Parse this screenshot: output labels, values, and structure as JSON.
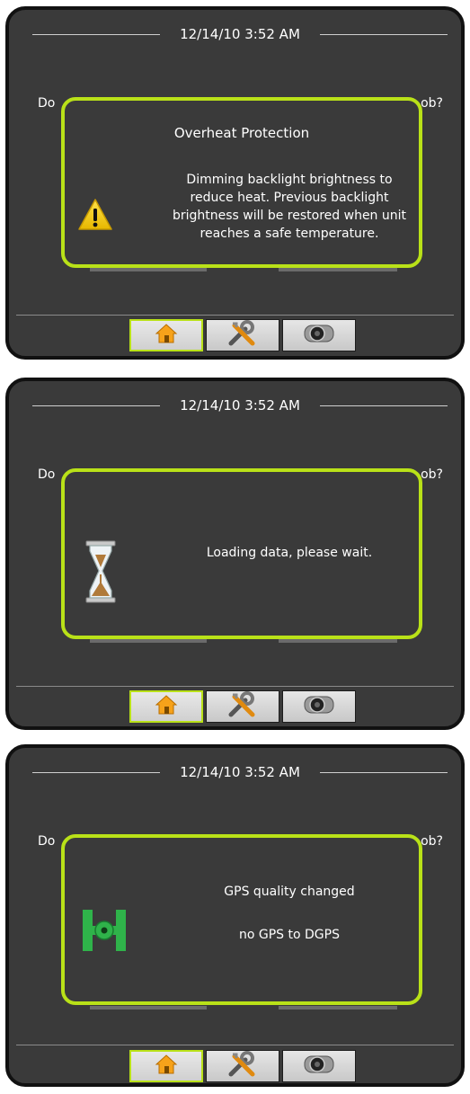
{
  "screens": [
    {
      "datetime": "12/14/10 3:52 AM",
      "bg_left_text": "Do",
      "bg_right_text": "ob?",
      "dialog": {
        "title": "Overheat Protection",
        "message": "Dimming backlight brightness to reduce heat.  Previous backlight brightness will be restored when unit reaches a safe temperature.",
        "icon": "warning-icon"
      }
    },
    {
      "datetime": "12/14/10 3:52 AM",
      "bg_left_text": "Do",
      "bg_right_text": "ob?",
      "dialog": {
        "message": "Loading data, please wait.",
        "icon": "hourglass-icon"
      }
    },
    {
      "datetime": "12/14/10 3:52 AM",
      "bg_left_text": "Do",
      "bg_right_text": "ob?",
      "dialog": {
        "message": "GPS quality changed",
        "message2": "no GPS to DGPS",
        "icon": "gps-satellite-icon"
      }
    }
  ],
  "tabs": [
    {
      "name": "home",
      "icon": "home-icon",
      "active": true
    },
    {
      "name": "tools",
      "icon": "tools-icon",
      "active": false
    },
    {
      "name": "camera",
      "icon": "camera-icon",
      "active": false
    }
  ],
  "colors": {
    "panel_bg": "#3a3a3a",
    "dialog_border": "#b9e118",
    "text": "#ffffff",
    "warning_yellow": "#f5d000",
    "gps_green": "#2fb34a"
  }
}
